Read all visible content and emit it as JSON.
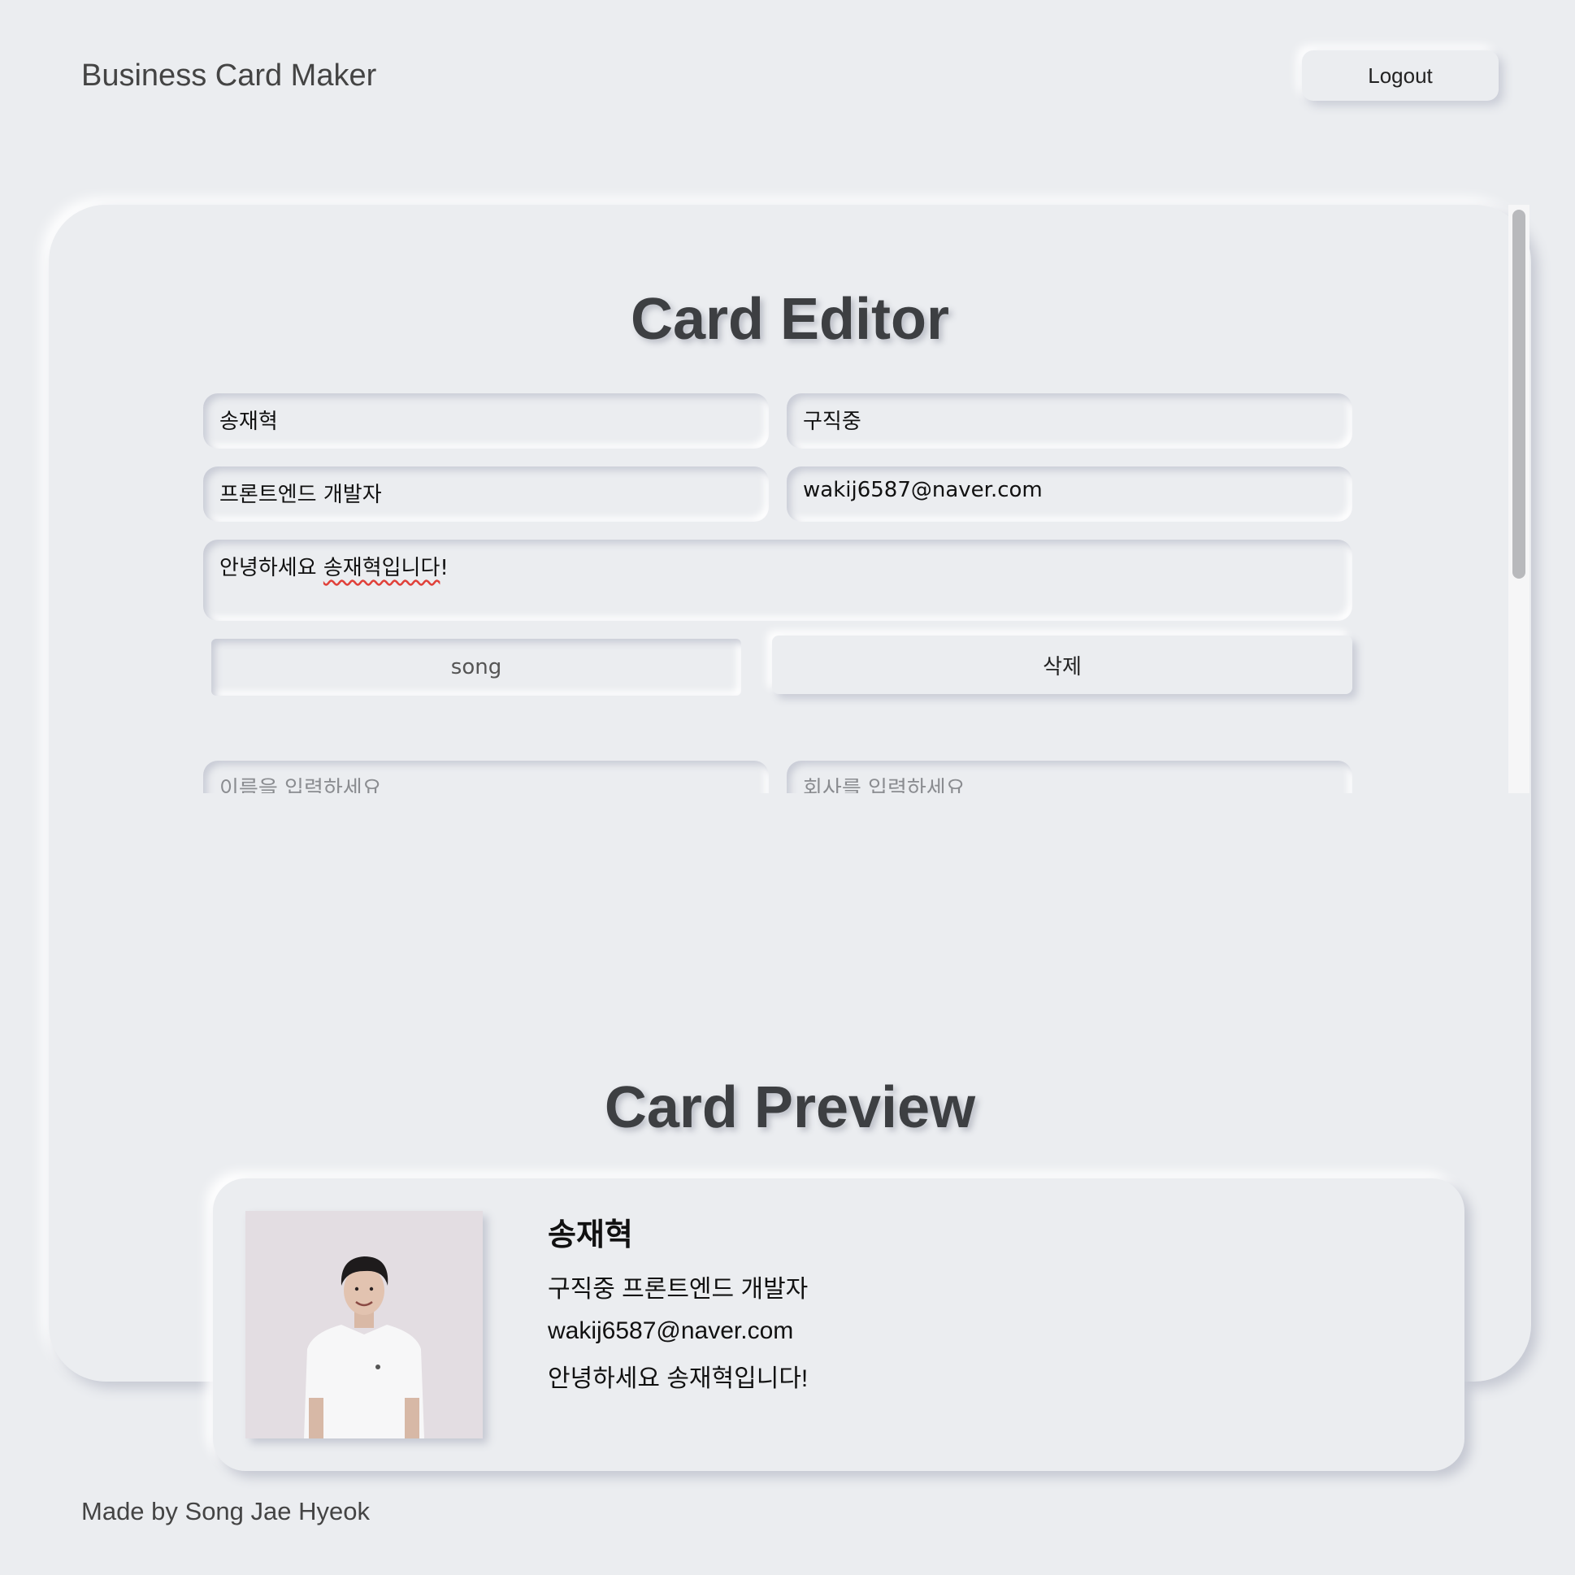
{
  "header": {
    "title": "Business Card Maker",
    "logout_label": "Logout"
  },
  "editor": {
    "title": "Card Editor",
    "card": {
      "name": "송재혁",
      "company": "구직중",
      "title": "프론트엔드 개발자",
      "email": "wakij6587@naver.com",
      "message_prefix": "안녕하세요 ",
      "message_spell": "송재혁입니다",
      "message_suffix": "!",
      "file_label": "song",
      "delete_label": "삭제"
    },
    "new_card": {
      "name_placeholder": "이름을 입력하세요",
      "company_placeholder": "회사를 입력하세요"
    }
  },
  "preview": {
    "title": "Card Preview",
    "name": "송재혁",
    "company_title": "구직중 프론트엔드 개발자",
    "email": "wakij6587@naver.com",
    "message": "안녕하세요 송재혁입니다!"
  },
  "footer": {
    "text": "Made by Song Jae Hyeok"
  },
  "colors": {
    "background": "#ebedf0",
    "title_text": "#3d3f42",
    "spell_underline": "#e0413a"
  }
}
